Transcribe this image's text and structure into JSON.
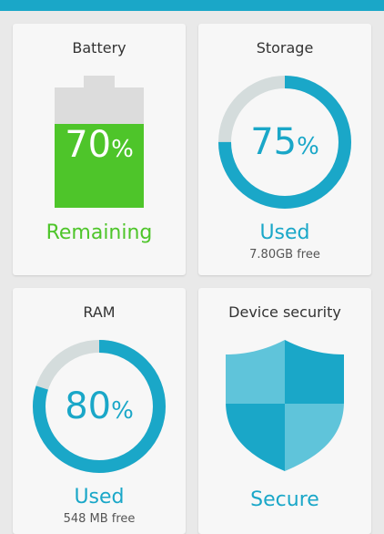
{
  "colors": {
    "accent": "#1aa7c8",
    "ring_track": "#d4dcdc",
    "battery_green": "#4ec52a",
    "battery_empty": "#dcdcdc",
    "shield_dark": "#1aa7c8",
    "shield_light": "#5fc4da"
  },
  "battery": {
    "title": "Battery",
    "percent": 70,
    "percent_text": "70",
    "percent_sign": "%",
    "status": "Remaining"
  },
  "storage": {
    "title": "Storage",
    "percent": 75,
    "percent_text": "75",
    "percent_sign": "%",
    "status": "Used",
    "free": "7.80GB free"
  },
  "ram": {
    "title": "RAM",
    "percent": 80,
    "percent_text": "80",
    "percent_sign": "%",
    "status": "Used",
    "free": "548 MB free"
  },
  "security": {
    "title": "Device security",
    "icon": "shield-icon",
    "status": "Secure"
  }
}
